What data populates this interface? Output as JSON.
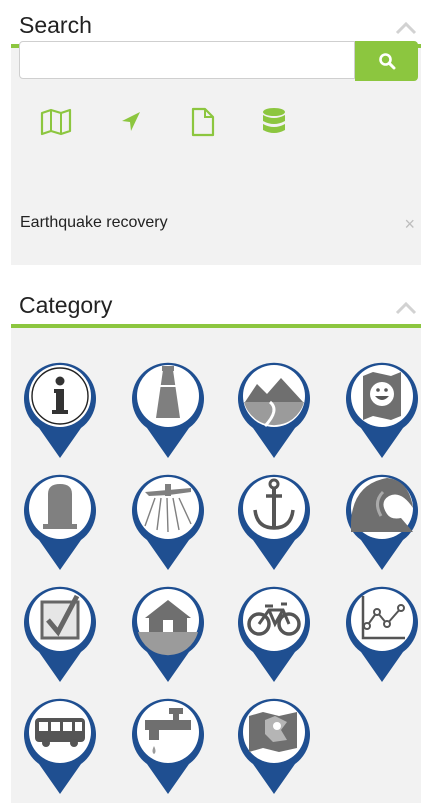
{
  "search_panel": {
    "title": "Search",
    "collapse_icon": "chevron-up-icon",
    "search_input": {
      "value": "",
      "placeholder": ""
    },
    "search_button_icon": "magnifier-icon",
    "tools": [
      {
        "name": "map-icon"
      },
      {
        "name": "locate-arrow-icon"
      },
      {
        "name": "document-icon"
      },
      {
        "name": "database-icon"
      }
    ],
    "active_layer": {
      "label": "Earthquake recovery",
      "close_symbol": "×"
    }
  },
  "category_panel": {
    "title": "Category",
    "collapse_icon": "chevron-up-icon",
    "categories": [
      {
        "name": "info-icon"
      },
      {
        "name": "lighthouse-icon"
      },
      {
        "name": "landscape-road-icon"
      },
      {
        "name": "smiley-map-icon"
      },
      {
        "name": "gravestone-icon"
      },
      {
        "name": "aircraft-spraying-icon"
      },
      {
        "name": "anchor-icon"
      },
      {
        "name": "wave-icon"
      },
      {
        "name": "checkbox-icon"
      },
      {
        "name": "house-icon"
      },
      {
        "name": "bicycle-icon"
      },
      {
        "name": "line-graph-icon"
      },
      {
        "name": "bus-icon"
      },
      {
        "name": "water-tap-icon"
      },
      {
        "name": "folded-map-icon"
      }
    ]
  },
  "colors": {
    "accent": "#8cc63f",
    "pin_blue": "#1f4f91",
    "icon_gray": "#808080",
    "panel_bg": "#f2f2f2"
  }
}
